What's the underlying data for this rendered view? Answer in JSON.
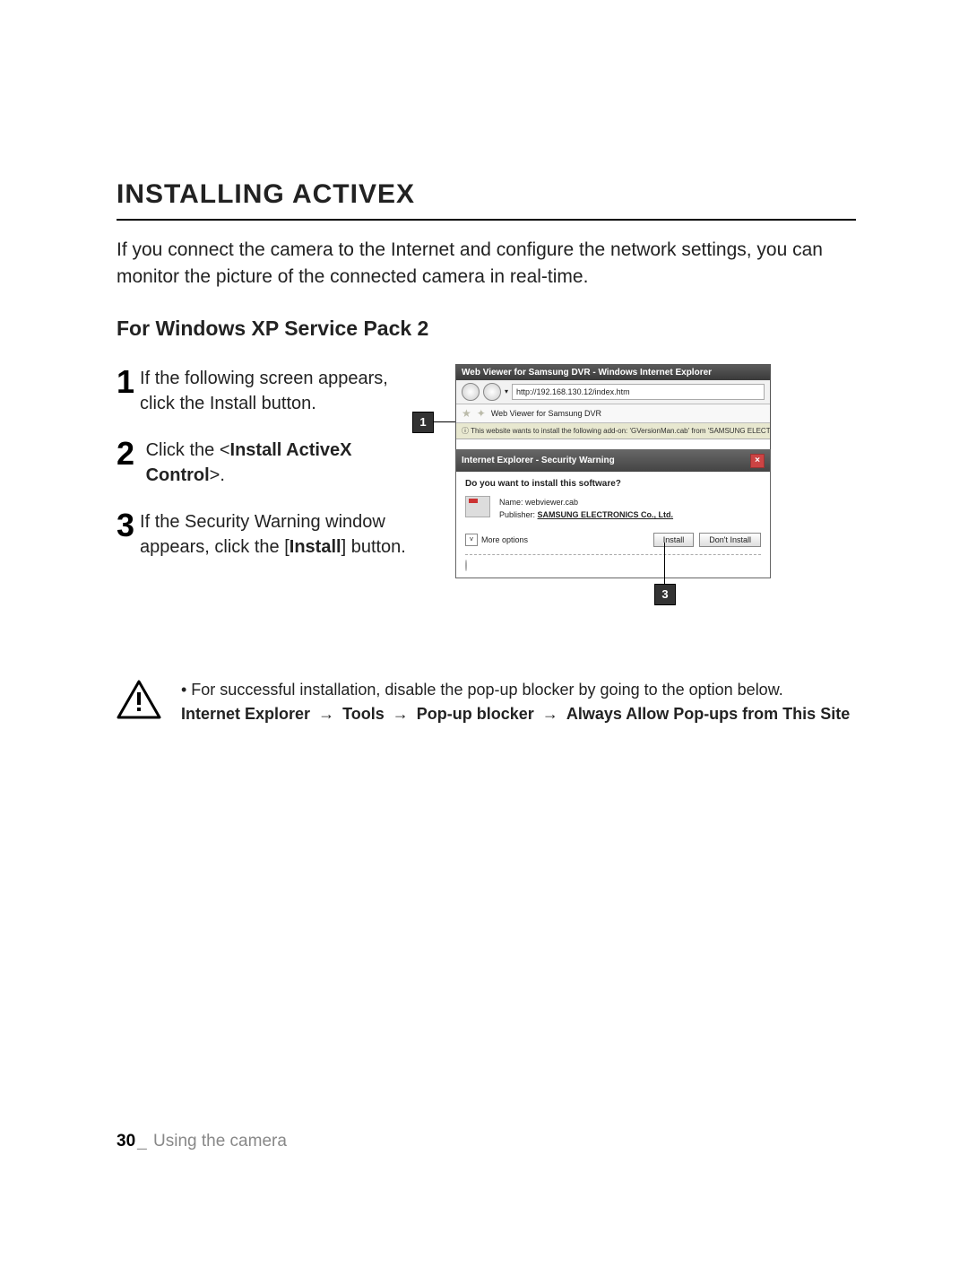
{
  "heading": "INSTALLING ACTIVEX",
  "intro": "If you connect the camera to the Internet and configure the network settings, you can monitor the picture of the connected camera in real-time.",
  "subheading": "For Windows XP Service Pack 2",
  "steps": {
    "s1": {
      "num": "1",
      "text": "If the following screen appears, click the Install button."
    },
    "s2": {
      "num": "2",
      "pre": "Click the <",
      "bold": "Install ActiveX Control",
      "post": ">."
    },
    "s3": {
      "num": "3",
      "pre": "If the Security Warning window appears, click the [",
      "bold": "Install",
      "post": "] button."
    }
  },
  "callouts": {
    "c1": "1",
    "c3": "3"
  },
  "ie": {
    "title": "Web Viewer for Samsung DVR - Windows Internet Explorer",
    "url": "http://192.168.130.12/index.htm",
    "tab": "Web Viewer for Samsung DVR",
    "infobar": "This website wants to install the following add-on: 'GVersionMan.cab' from 'SAMSUNG ELECTRONICS Co., Ltd.'"
  },
  "dialog": {
    "title": "Internet Explorer - Security Warning",
    "question": "Do you want to install this software?",
    "name_label": "Name:",
    "name_value": "webviewer.cab",
    "publisher_label": "Publisher:",
    "publisher_value": "SAMSUNG ELECTRONICS Co., Ltd.",
    "more": "More options",
    "install": "Install",
    "dont_install": "Don't Install"
  },
  "note": {
    "bullet": "• For successful installation, disable the pop-up blocker by going to the option below.",
    "path_parts": [
      "Internet Explorer",
      "Tools",
      "Pop-up blocker",
      "Always Allow Pop-ups from This Site"
    ],
    "arrow": "→"
  },
  "footer": {
    "page": "30",
    "sep": "_",
    "section": "Using the camera"
  }
}
